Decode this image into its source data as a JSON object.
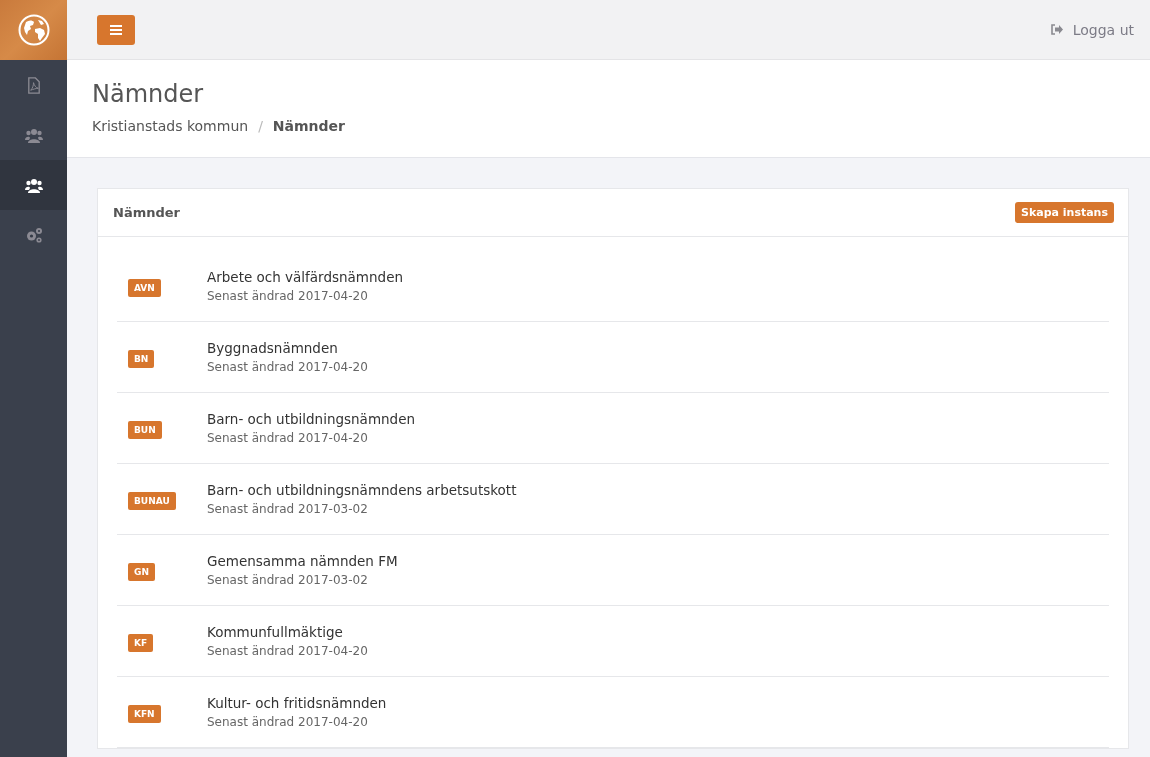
{
  "sidebar": {
    "items": [
      {
        "kind": "pdf",
        "selected": false
      },
      {
        "kind": "users",
        "selected": false
      },
      {
        "kind": "users",
        "selected": true
      },
      {
        "kind": "gears",
        "selected": false
      }
    ]
  },
  "topbar": {
    "logout": "Logga ut"
  },
  "header": {
    "title": "Nämnder",
    "breadcrumb": [
      {
        "label": "Kristianstads kommun",
        "current": false
      },
      {
        "label": "Nämnder",
        "current": true
      }
    ],
    "separator": "/"
  },
  "panel": {
    "title": "Nämnder",
    "action": "Skapa instans",
    "items": [
      {
        "badge": "AVN",
        "name": "Arbete och välfärdsnämnden",
        "modified": "Senast ändrad 2017-04-20"
      },
      {
        "badge": "BN",
        "name": "Byggnadsnämnden",
        "modified": "Senast ändrad 2017-04-20"
      },
      {
        "badge": "BUN",
        "name": "Barn- och utbildningsnämnden",
        "modified": "Senast ändrad 2017-04-20"
      },
      {
        "badge": "BUNAU",
        "name": "Barn- och utbildningsnämndens arbetsutskott",
        "modified": "Senast ändrad 2017-03-02"
      },
      {
        "badge": "GN",
        "name": "Gemensamma nämnden FM",
        "modified": "Senast ändrad 2017-03-02"
      },
      {
        "badge": "KF",
        "name": "Kommunfullmäktige",
        "modified": "Senast ändrad 2017-04-20"
      },
      {
        "badge": "KFN",
        "name": "Kultur- och fritidsnämnden",
        "modified": "Senast ändrad 2017-04-20"
      }
    ]
  }
}
